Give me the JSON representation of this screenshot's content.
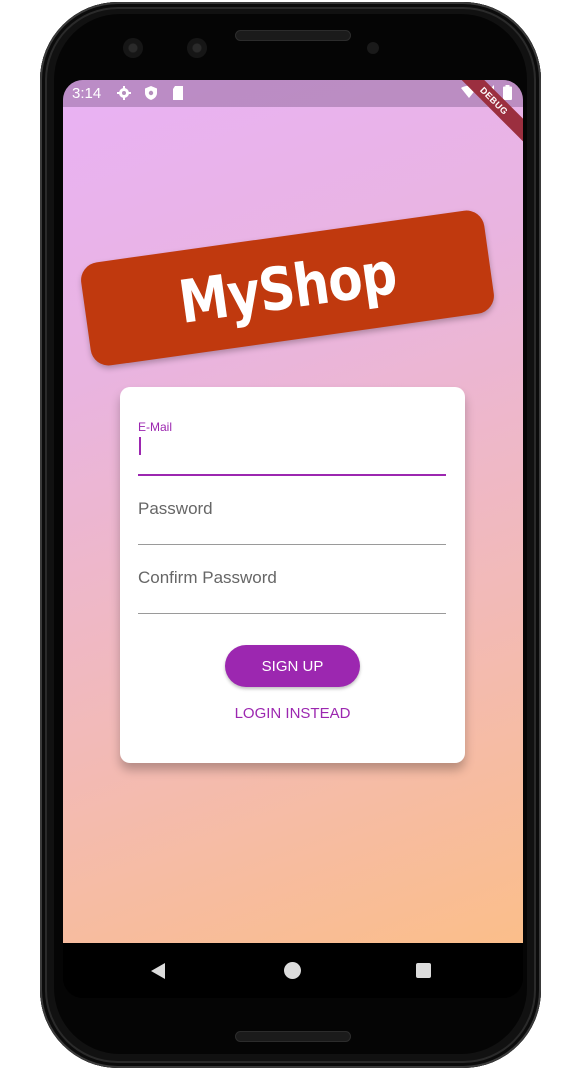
{
  "status_bar": {
    "time": "3:14",
    "left_icons": [
      "settings-icon",
      "shield-icon",
      "sd-card-icon"
    ],
    "right_icons": [
      "wifi-icon",
      "signal-icon",
      "battery-icon"
    ]
  },
  "debug_banner": "DEBUG",
  "logo": {
    "text": "MyShop",
    "color": "#c0390e"
  },
  "form": {
    "email_label": "E-Mail",
    "email_value": "",
    "password_placeholder": "Password",
    "confirm_password_placeholder": "Confirm Password",
    "signup_label": "SIGN UP",
    "login_label": "LOGIN INSTEAD"
  },
  "theme": {
    "accent": "#9c27b0",
    "gradient_start": "#e9b2f5",
    "gradient_end": "#fbbe8a"
  },
  "nav_bar": {
    "buttons": [
      "back-icon",
      "home-icon",
      "recents-icon"
    ]
  }
}
